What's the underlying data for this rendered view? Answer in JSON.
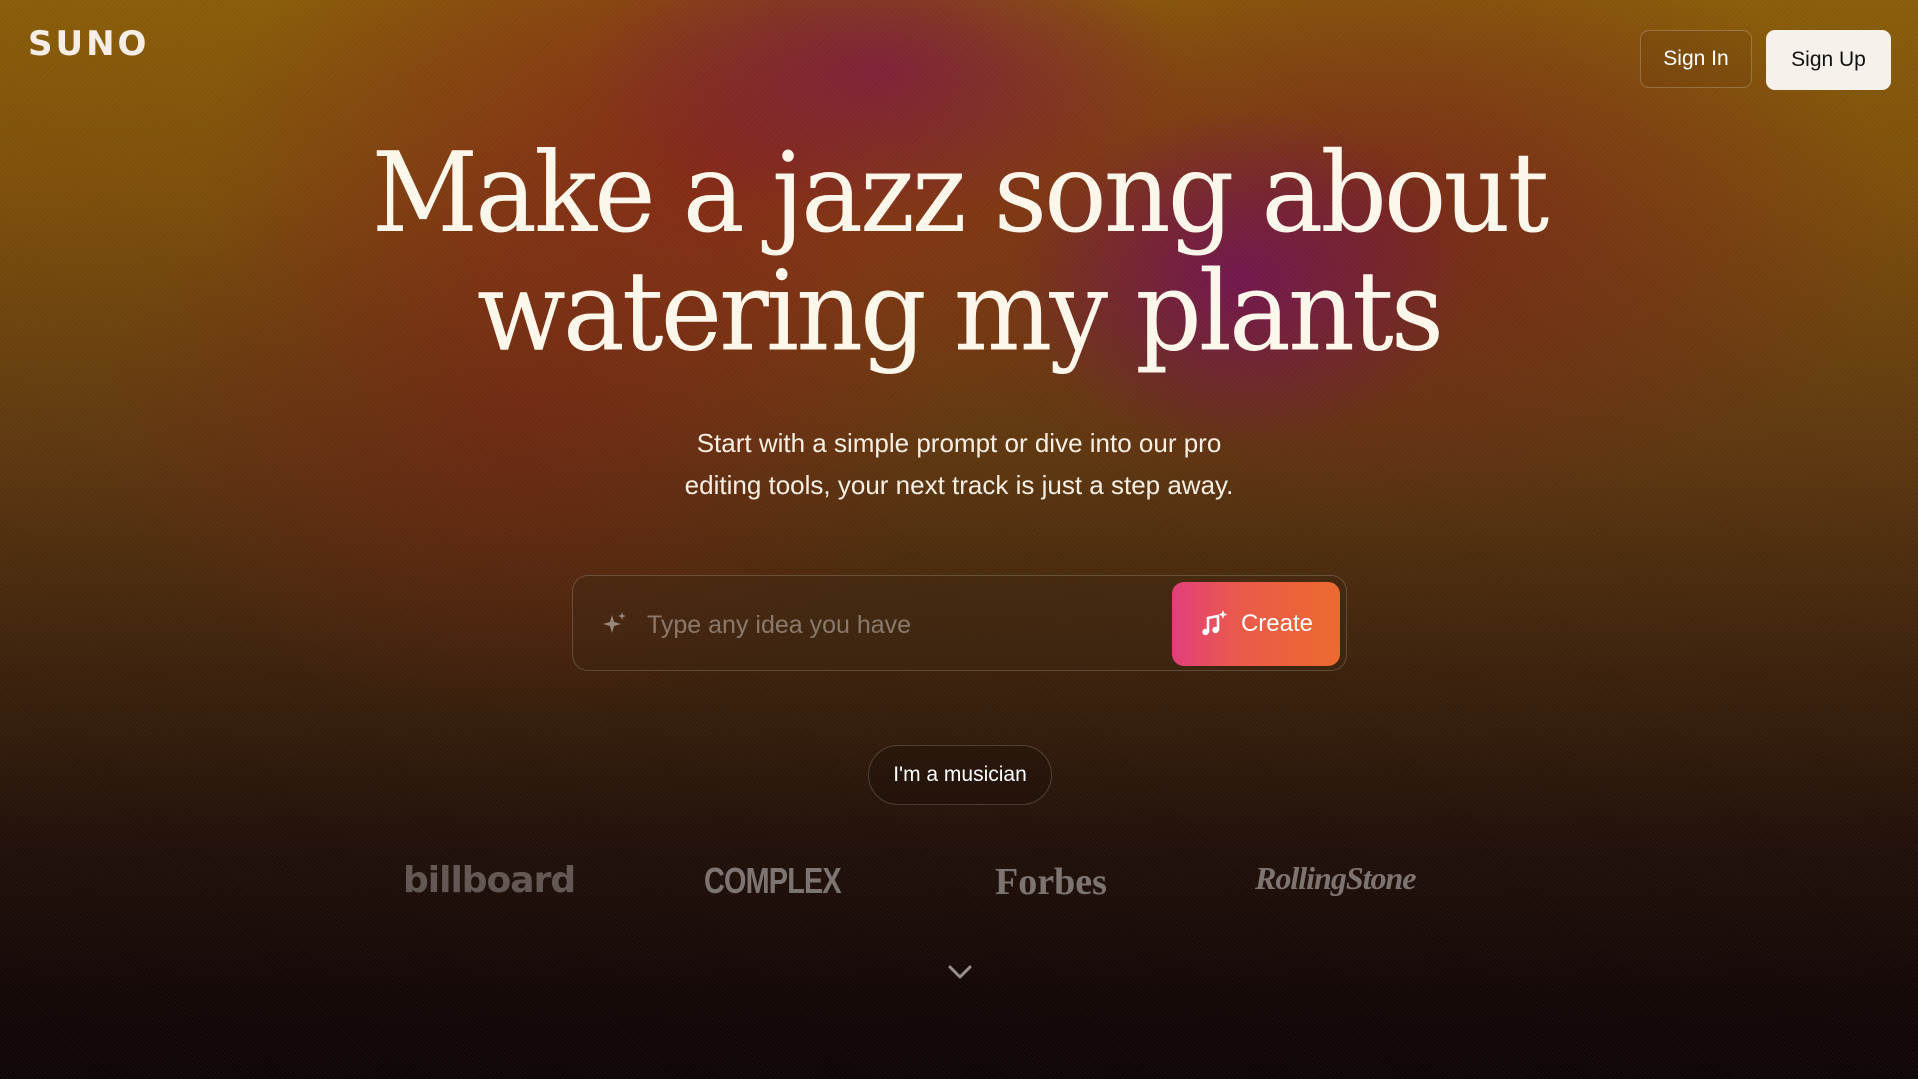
{
  "brand": {
    "logo_text": "SUNO"
  },
  "nav": {
    "sign_in_label": "Sign In",
    "sign_up_label": "Sign Up"
  },
  "hero": {
    "title_line1": "Make a jazz song about",
    "title_line2": "watering my plants",
    "subtitle_line1": "Start with a simple prompt or dive into our pro",
    "subtitle_line2": "editing tools, your next track is just a step away."
  },
  "prompt": {
    "placeholder": "Type any idea you have",
    "value": "",
    "create_label": "Create"
  },
  "musician_label": "I'm a musician",
  "press_logos": [
    "billboard",
    "COMPLEX",
    "Forbes",
    "RollingStone"
  ],
  "icons": {
    "sparkle": "sparkle-icon",
    "create": "music-note-sparkle-icon",
    "scroll": "chevron-down-icon"
  },
  "colors": {
    "accent_start": "#e23f7a",
    "accent_end": "#ec6a30",
    "signup_bg": "#f6f1ea"
  }
}
